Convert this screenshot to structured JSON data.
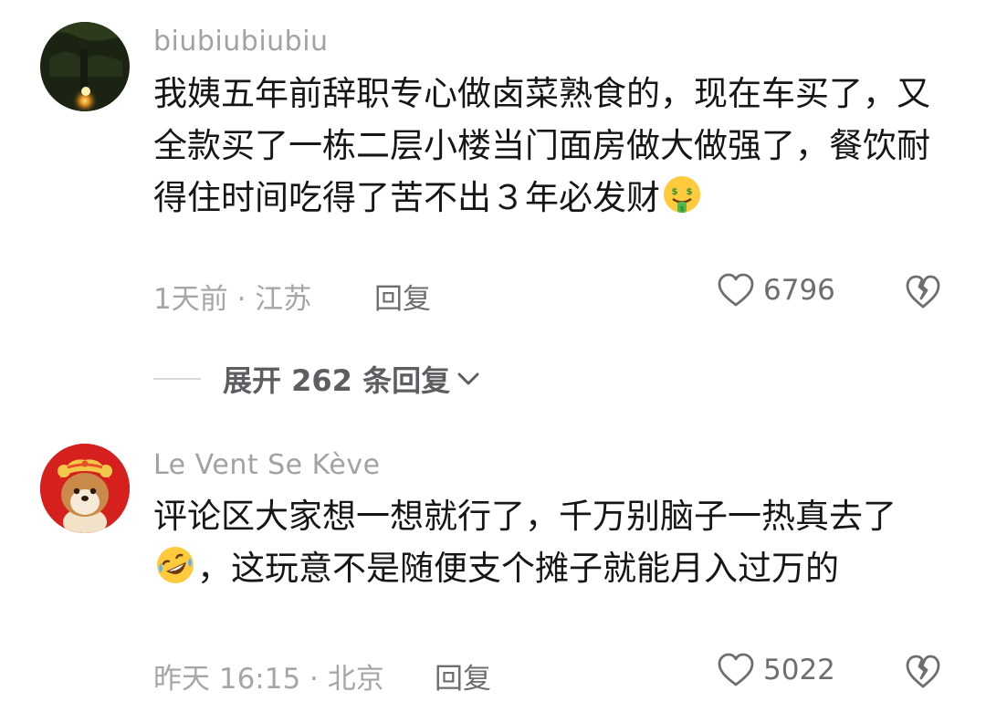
{
  "comments": [
    {
      "username": "biubiubiubiu",
      "text_before_emoji": "我姨五年前辞职专心做卤菜熟食的，现在车买了，又全款买了一栋二层小楼当门面房做大做强了，餐饮耐得住时间吃得了苦不出３年必发财",
      "text_after_emoji": "",
      "emoji_icon": "money-mouth-face-icon",
      "meta": "1天前 · 江苏",
      "reply_label": "回复",
      "likes": "6796",
      "avatar_icon": "dark-tree-night-photo-icon"
    },
    {
      "username": "Le Vent Se Kève",
      "text_before_emoji": "评论区大家想一想就行了，千万别脑子一热真去了",
      "text_after_emoji": "，这玩意不是随便支个摊子就能月入过万的",
      "emoji_icon": "rolling-on-floor-laughing-icon",
      "meta": "昨天 16:15 · 北京",
      "reply_label": "回复",
      "likes": "5022",
      "avatar_icon": "lion-dance-dog-avatar-icon"
    }
  ],
  "expand_replies_label": "展开 262 条回复",
  "colors": {
    "username": "#a2a2a6",
    "text": "#161616",
    "meta": "#a6a6aa",
    "action": "#6e6e72",
    "avatar_red": "#d6201e"
  }
}
